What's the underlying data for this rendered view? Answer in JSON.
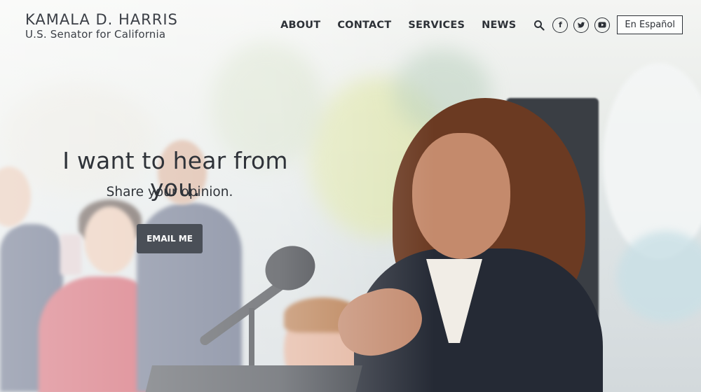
{
  "brand": {
    "name": "KAMALA D. HARRIS",
    "subtitle": "U.S. Senator for California"
  },
  "nav": {
    "items": [
      {
        "label": "ABOUT"
      },
      {
        "label": "CONTACT"
      },
      {
        "label": "SERVICES"
      },
      {
        "label": "NEWS"
      }
    ],
    "icons": [
      "search-icon",
      "facebook-icon",
      "twitter-icon",
      "youtube-icon"
    ],
    "language_button": "En Español"
  },
  "hero": {
    "title": "I want to hear from you.",
    "subtitle": "Share your opinion.",
    "cta_label": "EMAIL ME"
  },
  "colors": {
    "button_bg": "#4a4f57",
    "text_dark": "#2d3137"
  }
}
